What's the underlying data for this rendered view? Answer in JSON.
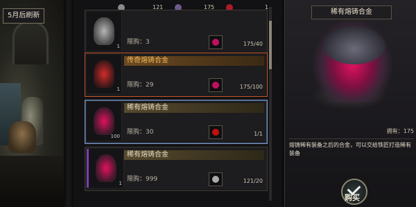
{
  "refresh_tag": "5月后刷新",
  "currencies": [
    {
      "icon": "gem-icon",
      "value": "121"
    },
    {
      "icon": "crystal-icon",
      "value": "175"
    },
    {
      "icon": "red-orb-icon",
      "value": "1"
    }
  ],
  "items": [
    {
      "name": "",
      "count": "1",
      "limit": "限购：3",
      "stock": "175/40",
      "rarity": "plain"
    },
    {
      "name": "传奇熔铸合金",
      "count": "1",
      "limit": "限购：29",
      "stock": "175/100",
      "rarity": "legend"
    },
    {
      "name": "稀有熔铸合金",
      "count": "100",
      "limit": "限购：30",
      "stock": "1/1",
      "rarity": "selected"
    },
    {
      "name": "稀有熔铸合金",
      "count": "1",
      "limit": "限购：999",
      "stock": "121/20",
      "rarity": "rare"
    }
  ],
  "detail": {
    "title": "稀有熔铸合金",
    "owned": "拥有：175",
    "description": "熔铸稀有装备之后的合金，可以交给铁匠打造稀有装备"
  },
  "buy_label": "购买",
  "colors": {
    "accent_pink": "#e1115f",
    "legend_orange": "#c4542a",
    "selected_blue": "#7d93b8"
  }
}
